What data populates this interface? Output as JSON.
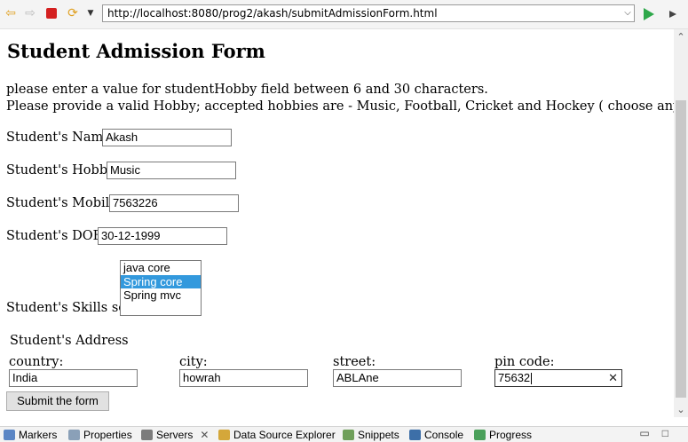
{
  "browser": {
    "url": "http://localhost:8080/prog2/akash/submitAdmissionForm.html"
  },
  "page": {
    "title": "Student Admission Form",
    "errors": [
      "please enter a value for studentHobby field between 6 and 30 characters.",
      "Please provide a valid Hobby; accepted hobbies are - Music, Football, Cricket and Hockey ( choose anyone )"
    ],
    "fields": {
      "name": {
        "label": "Student's Name:",
        "value": "Akash"
      },
      "hobby": {
        "label": "Student's Hobby:",
        "value": "Music"
      },
      "mobile": {
        "label": "Student's Mobile:",
        "value": "7563226"
      },
      "dob": {
        "label": "Student's DOB:",
        "value": "30-12-1999"
      },
      "skills": {
        "label": "Student's Skills set:",
        "options": [
          "java core",
          "Spring core",
          "Spring mvc"
        ],
        "selected": "Spring core"
      }
    },
    "address": {
      "title": "Student's Address",
      "country": {
        "label": "country:",
        "value": "India"
      },
      "city": {
        "label": "city:",
        "value": "howrah"
      },
      "street": {
        "label": "street:",
        "value": "ABLAne"
      },
      "pincode": {
        "label": "pin code:",
        "value": "75632"
      }
    },
    "submit_label": "Submit the form",
    "selection_color": "#3399dd"
  },
  "panel_tabs": [
    {
      "label": "Markers",
      "icon": "markers-icon"
    },
    {
      "label": "Properties",
      "icon": "properties-icon"
    },
    {
      "label": "Servers",
      "icon": "servers-icon"
    },
    {
      "label": "Data Source Explorer",
      "icon": "data-source-icon"
    },
    {
      "label": "Snippets",
      "icon": "snippets-icon"
    },
    {
      "label": "Console",
      "icon": "console-icon"
    },
    {
      "label": "Progress",
      "icon": "progress-icon"
    }
  ]
}
